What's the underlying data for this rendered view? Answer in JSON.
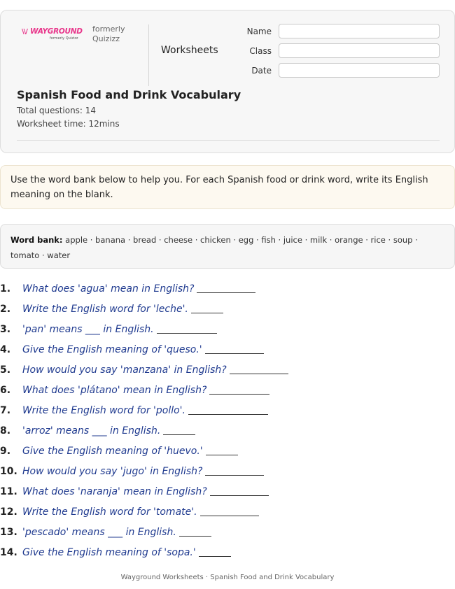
{
  "header": {
    "logo_text": "WAYGROUND",
    "logo_subtext": "formerly Quizizz",
    "formerly_line1": "formerly",
    "formerly_line2": "Quizizz",
    "worksheets_label": "Worksheets",
    "fields": [
      {
        "label": "Name",
        "value": ""
      },
      {
        "label": "Class",
        "value": ""
      },
      {
        "label": "Date",
        "value": ""
      }
    ],
    "title": "Spanish Food and Drink Vocabulary",
    "total_questions": "Total questions: 14",
    "worksheet_time": "Worksheet time: 12mins"
  },
  "instructions": "Use the word bank below to help you. For each Spanish food or drink word, write its English meaning on the blank.",
  "word_bank": {
    "label": "Word bank:",
    "words": "apple · banana · bread · cheese · chicken · egg · fish · juice · milk · orange · rice · soup · tomato · water"
  },
  "questions": [
    {
      "number": "1.",
      "text": "What does 'agua' mean in English?"
    },
    {
      "number": "2.",
      "text": "Write the English word for 'leche'."
    },
    {
      "number": "3.",
      "text": "'pan' means ___ in English."
    },
    {
      "number": "4.",
      "text": "Give the English meaning of 'queso.'"
    },
    {
      "number": "5.",
      "text": "How would you say 'manzana' in English?"
    },
    {
      "number": "6.",
      "text": "What does 'plátano' mean in English?"
    },
    {
      "number": "7.",
      "text": "Write the English word for 'pollo'."
    },
    {
      "number": "8.",
      "text": "'arroz' means ___ in English."
    },
    {
      "number": "9.",
      "text": "Give the English meaning of 'huevo.'"
    },
    {
      "number": "10.",
      "text": "How would you say 'jugo' in English?"
    },
    {
      "number": "11.",
      "text": "What does 'naranja' mean in English?"
    },
    {
      "number": "12.",
      "text": "Write the English word for 'tomate'."
    },
    {
      "number": "13.",
      "text": "'pescado' means ___ in English."
    },
    {
      "number": "14.",
      "text": "Give the English meaning of 'sopa.'"
    }
  ],
  "footer": "Wayground Worksheets · Spanish Food and Drink Vocabulary"
}
